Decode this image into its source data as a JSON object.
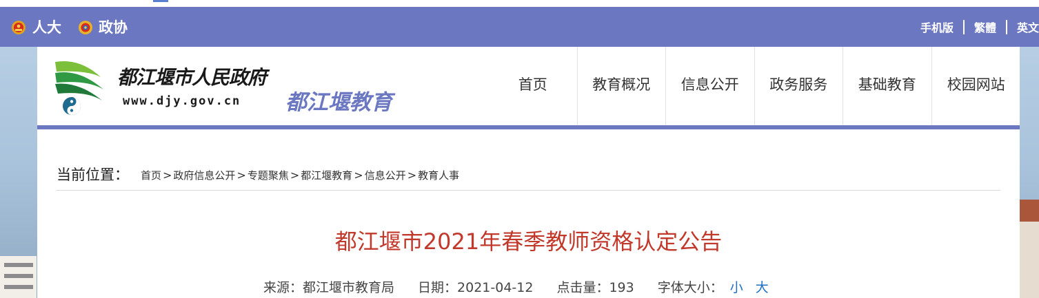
{
  "topbar": {
    "left_links": [
      {
        "label": "人大",
        "icon": "national-emblem-icon"
      },
      {
        "label": "政协",
        "icon": "cppcc-emblem-icon"
      }
    ],
    "right_links": [
      "手机版",
      "繁體",
      "英文"
    ]
  },
  "header": {
    "site_name": "都江堰市人民政府",
    "site_url": "www.djy.gov.cn",
    "sub_name": "都江堰教育",
    "logo_icon": "dujiangyan-logo-icon"
  },
  "nav": {
    "items": [
      "首页",
      "教育概况",
      "信息公开",
      "政务服务",
      "基础教育",
      "校园网站"
    ]
  },
  "breadcrumb": {
    "title": "当前位置：",
    "items": [
      "首页",
      "政府信息公开",
      "专题聚焦",
      "都江堰教育",
      "信息公开",
      "教育人事"
    ],
    "separator": ">"
  },
  "article": {
    "title": "都江堰市2021年春季教师资格认定公告",
    "source_label": "来源：都江堰市教育局",
    "date_label": "日期：2021-04-12",
    "clicks_label": "点击量：193",
    "font_size_label": "字体大小：",
    "font_small": "小",
    "font_large": "大"
  },
  "colors": {
    "brand": "#6b77c1",
    "title_red": "#c0392b",
    "link_blue": "#1f6fc5"
  }
}
